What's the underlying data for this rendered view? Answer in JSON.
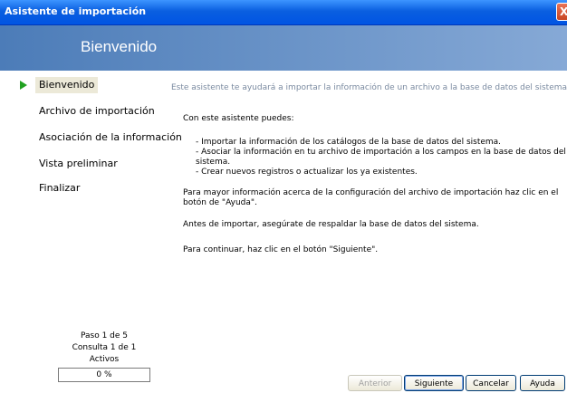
{
  "window": {
    "title": "Asistente de importación",
    "close_glyph": "X"
  },
  "banner": {
    "heading": "Bienvenido"
  },
  "sidebar": {
    "steps": [
      {
        "label": "Bienvenido",
        "active": true
      },
      {
        "label": "Archivo de importación"
      },
      {
        "label": "Asociación de la información"
      },
      {
        "label": "Vista preliminar"
      },
      {
        "label": "Finalizar"
      }
    ],
    "step_indicator_color": "#21a121",
    "progress": {
      "step_text": "Paso 1 de 5",
      "query_text": "Consulta 1 de 1",
      "status_text": "Activos",
      "percent_text": "0 %",
      "value": 0
    }
  },
  "content": {
    "intro": "Este asistente te ayudará a importar la información de un archivo a la base de datos del sistema.",
    "subtitle": "Con este asistente puedes:",
    "bullets": [
      "- Importar la información de los catálogos de la base de datos del sistema.",
      "- Asociar la información en tu archivo de importación a los campos en la base de datos del sistema.",
      "- Crear nuevos registros o actualizar los ya existentes."
    ],
    "help_text": "Para mayor información acerca de la configuración del archivo de importación haz clic en el botón de \"Ayuda\".",
    "backup_text": "Antes de importar, asegúrate de respaldar la base de datos del sistema.",
    "continue_text": "Para continuar, haz clic en el botón \"Siguiente\"."
  },
  "buttons": {
    "back": {
      "label": "Anterior",
      "enabled": false
    },
    "next": {
      "label": "Siguiente"
    },
    "cancel": {
      "label": "Cancelar"
    },
    "help": {
      "label": "Ayuda"
    }
  },
  "colors": {
    "titlebar": "#0054e3",
    "banner_start": "#4c7cb8",
    "banner_end": "#86a9d6",
    "active_step_bg": "#ece9d8"
  }
}
